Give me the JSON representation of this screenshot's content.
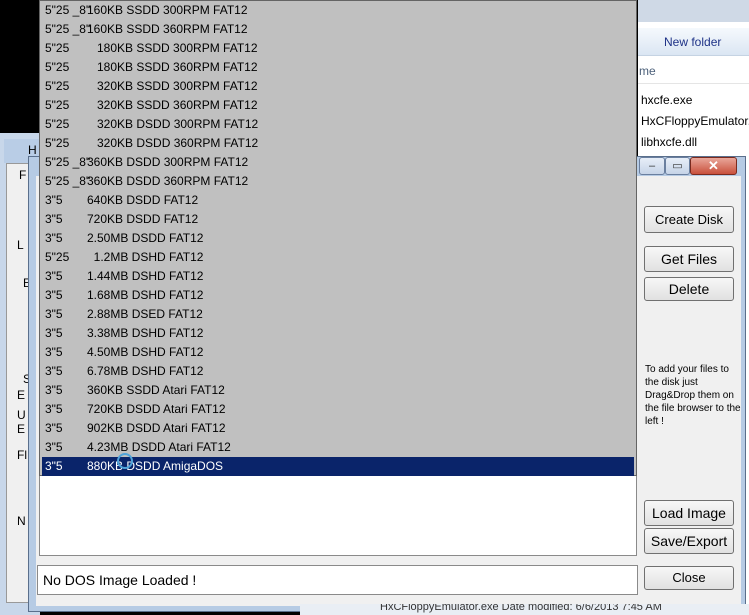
{
  "explorer": {
    "new_folder": "New folder",
    "column_header": "me",
    "files": [
      "hxcfe.exe",
      "HxCFloppyEmulator.",
      "libhxcfe.dll"
    ],
    "status_fragment": "HxCFloppyEmulator.exe  Date modified: 6/6/2013 7:45 AM"
  },
  "left_window": {
    "title_frag": "H",
    "chars": [
      "F",
      "L",
      "E",
      "S",
      "E",
      "U",
      "E",
      "Fl",
      "N"
    ]
  },
  "dialog": {
    "buttons": {
      "create_disk": "Create Disk",
      "get_files": "Get Files",
      "delete": "Delete",
      "load_image": "Load Image",
      "save_export": "Save/Export",
      "close": "Close"
    },
    "hint": "To add your files to the disk just Drag&Drop them on the file browser to the left !",
    "status": "No DOS Image Loaded !",
    "caption_glyphs": {
      "min": "‒",
      "max": "▭",
      "close": "✕"
    }
  },
  "format_list": {
    "selected_index": 24,
    "items": [
      {
        "size": "5\"25 _8\"",
        "desc": "160KB SSDD 300RPM FAT12"
      },
      {
        "size": "5\"25 _8\"",
        "desc": "160KB SSDD 360RPM FAT12"
      },
      {
        "size": "5\"25",
        "desc": "   180KB SSDD 300RPM FAT12"
      },
      {
        "size": "5\"25",
        "desc": "   180KB SSDD 360RPM FAT12"
      },
      {
        "size": "5\"25",
        "desc": "   320KB SSDD 300RPM FAT12"
      },
      {
        "size": "5\"25",
        "desc": "   320KB SSDD 360RPM FAT12"
      },
      {
        "size": "5\"25",
        "desc": "   320KB DSDD 300RPM FAT12"
      },
      {
        "size": "5\"25",
        "desc": "   320KB DSDD 360RPM FAT12"
      },
      {
        "size": "5\"25 _8\"",
        "desc": "360KB DSDD 300RPM FAT12"
      },
      {
        "size": "5\"25 _8\"",
        "desc": "360KB DSDD 360RPM FAT12"
      },
      {
        "size": "3\"5",
        "desc": "640KB DSDD FAT12"
      },
      {
        "size": "3\"5",
        "desc": "720KB DSDD FAT12"
      },
      {
        "size": "3\"5",
        "desc": "2.50MB DSDD FAT12"
      },
      {
        "size": "5\"25",
        "desc": "  1.2MB DSHD FAT12"
      },
      {
        "size": "3\"5",
        "desc": "1.44MB DSHD FAT12"
      },
      {
        "size": "3\"5",
        "desc": "1.68MB DSHD FAT12"
      },
      {
        "size": "3\"5",
        "desc": "2.88MB DSED FAT12"
      },
      {
        "size": "3\"5",
        "desc": "3.38MB DSHD FAT12"
      },
      {
        "size": "3\"5",
        "desc": "4.50MB DSHD FAT12"
      },
      {
        "size": "3\"5",
        "desc": "6.78MB DSHD FAT12"
      },
      {
        "size": "3\"5",
        "desc": "360KB SSDD Atari FAT12"
      },
      {
        "size": "3\"5",
        "desc": "720KB DSDD Atari FAT12"
      },
      {
        "size": "3\"5",
        "desc": "902KB DSDD Atari FAT12"
      },
      {
        "size": "3\"5",
        "desc": "4.23MB DSDD Atari FAT12"
      },
      {
        "size": "3\"5",
        "desc": "880KB DSDD AmigaDOS"
      }
    ]
  },
  "colors": {
    "selection": "#0a246a",
    "list_bg": "#c0c0c0"
  }
}
